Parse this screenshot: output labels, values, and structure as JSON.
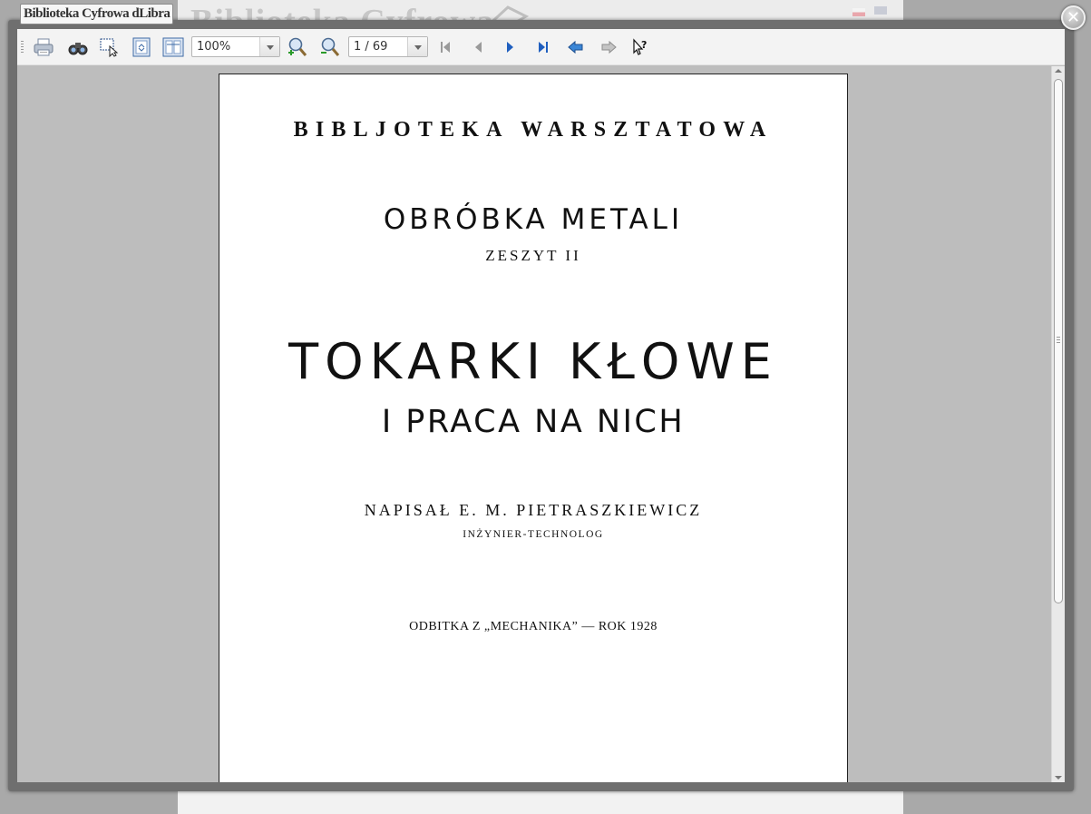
{
  "background": {
    "header_text": "Biblioteka Cyfrowa"
  },
  "site_title": "Biblioteka Cyfrowa dLibra",
  "viewer": {
    "close_icon": "close-icon",
    "toolbar": {
      "buttons": [
        "print-icon",
        "find-icon",
        "select-tool-icon",
        "fit-page-icon",
        "fit-width-icon",
        "zoom-in-icon",
        "zoom-out-icon",
        "first-page-icon",
        "previous-page-icon",
        "next-page-icon",
        "last-page-icon",
        "history-back-icon",
        "history-forward-icon",
        "help-icon"
      ],
      "zoom_value": "100%",
      "page_value": "1 / 69"
    },
    "document": {
      "series": "BIBLJOTEKA WARSZTATOWA",
      "subject": "OBRÓBKA METALI",
      "volume": "ZESZYT II",
      "title": "TOKARKI KŁOWE",
      "subtitle": "I PRACA NA NICH",
      "author": "NAPISAŁ E. M. PIETRASZKIEWICZ",
      "author_role": "INŻYNIER-TECHNOLOG",
      "imprint": "ODBITKA Z „MECHANIKA” — ROK 1928"
    }
  },
  "colors": {
    "accent_blue": "#1f5fbf",
    "overlay": "#a9a9a9",
    "viewer_bg": "#bdbdbd"
  }
}
